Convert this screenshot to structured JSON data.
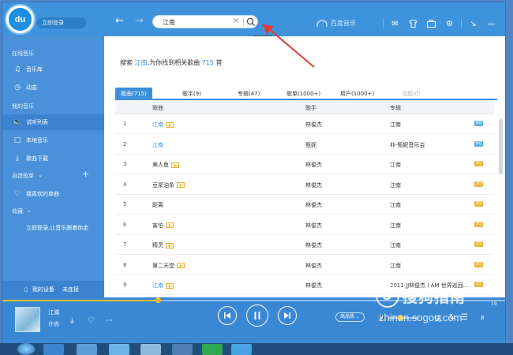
{
  "app": {
    "logo_text": "du",
    "login_label": "立即登录"
  },
  "search": {
    "value": "江南",
    "tooltip": "搜索"
  },
  "brand": {
    "label": "百度音乐"
  },
  "top_icons": [
    "mail-icon",
    "skin-icon",
    "toolbox-icon",
    "settings-icon",
    "mini-mode-icon",
    "minimize-icon",
    "close-icon"
  ],
  "sidebar": {
    "online_section": "在线音乐",
    "music_lib": "音乐库",
    "dynamic": "动态",
    "my_music_section": "我的音乐",
    "trial_list": "试听列表",
    "local_music": "本地音乐",
    "downloads": "歌曲下载",
    "custom_playlist": "自建歌单",
    "favorites": "我喜欢的单曲",
    "collection": "收藏",
    "login_hint": "立即登录,让音乐跟着你走",
    "device_label": "我的设备",
    "device_status": "未连接"
  },
  "result": {
    "prefix": "搜索",
    "keyword": "江南",
    "middle": ",为你找到相关歌曲",
    "count": "715",
    "suffix": "首"
  },
  "tabs": [
    {
      "label": "歌曲(715)"
    },
    {
      "label": "歌手(9)"
    },
    {
      "label": "专辑(47)"
    },
    {
      "label": "歌单(1000+)"
    },
    {
      "label": "用户(1000+)"
    },
    {
      "label": "话题(0)"
    }
  ],
  "table": {
    "headers": {
      "song": "歌曲",
      "artist": "歌手",
      "album": "专辑"
    },
    "rows": [
      {
        "idx": "1",
        "song": "江南",
        "mv": true,
        "link": true,
        "artist": "林俊杰",
        "album": "江南",
        "quality": "HQ"
      },
      {
        "idx": "2",
        "song": "江南",
        "mv": false,
        "link": true,
        "artist": "甄妮",
        "album": "非-甄妮音乐会",
        "quality": "HQ"
      },
      {
        "idx": "3",
        "song": "美人鱼",
        "mv": true,
        "link": false,
        "artist": "林俊杰",
        "album": "江南",
        "quality": "SQ"
      },
      {
        "idx": "4",
        "song": "豆浆油条",
        "mv": true,
        "link": false,
        "artist": "林俊杰",
        "album": "江南",
        "quality": "SQ"
      },
      {
        "idx": "5",
        "song": "距离",
        "mv": false,
        "link": false,
        "artist": "林俊杰",
        "album": "江南",
        "quality": "SQ"
      },
      {
        "idx": "6",
        "song": "害怕",
        "mv": true,
        "link": false,
        "artist": "林俊杰",
        "album": "江南",
        "quality": "SQ"
      },
      {
        "idx": "7",
        "song": "精灵",
        "mv": true,
        "link": false,
        "artist": "林俊杰",
        "album": "江南",
        "quality": "SQ"
      },
      {
        "idx": "8",
        "song": "第二天堂",
        "mv": true,
        "link": false,
        "artist": "林俊杰",
        "album": "江南",
        "quality": "SQ"
      },
      {
        "idx": "9",
        "song": "江南",
        "mv": true,
        "link": true,
        "artist": "林俊杰",
        "album": "2011 JJ林俊杰 I AM 世界巡回...",
        "quality": "SQ"
      }
    ]
  },
  "player": {
    "title": "江湖",
    "artist": "许嵩",
    "quality_label": "高品质",
    "lyrics_label": "词",
    "count": "8",
    "time": "19",
    "progress": 0.31,
    "volume": 0.4
  },
  "watermark": {
    "cn": "搜狗指南",
    "url": "zhinan.sogou.com"
  },
  "colors": {
    "accent": "#3f8fd9",
    "sidebar": "#4a91d9",
    "topbar": "#3f93dc",
    "arrow": "#e03a3a",
    "progress": "#f5c030"
  }
}
